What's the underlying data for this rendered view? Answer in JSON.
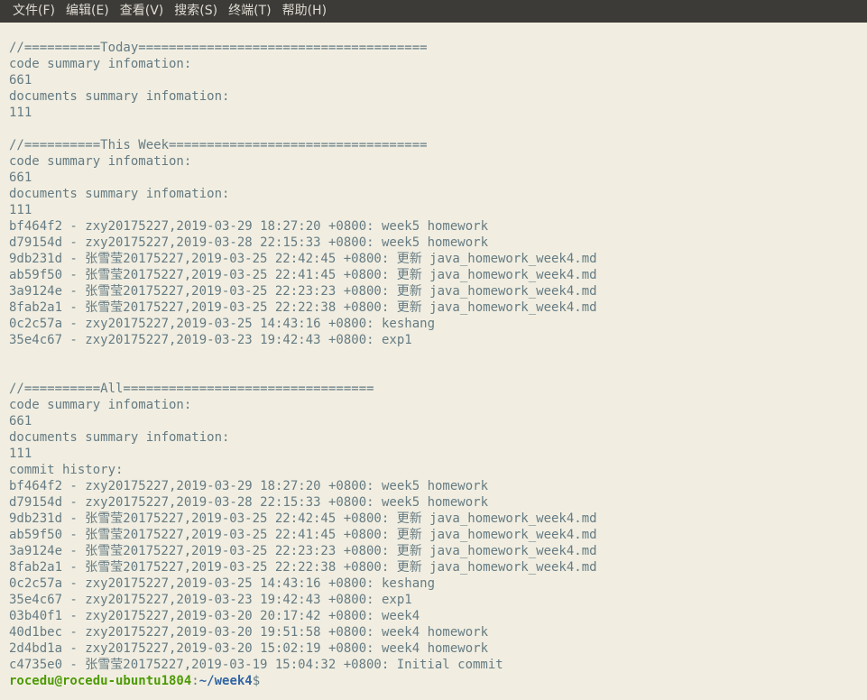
{
  "menubar": {
    "items": [
      "文件(F)",
      "编辑(E)",
      "查看(V)",
      "搜索(S)",
      "终端(T)",
      "帮助(H)"
    ]
  },
  "terminal": {
    "lines": [
      "//==========Today======================================",
      "code summary infomation:",
      "661",
      "documents summary infomation:",
      "111",
      "",
      "//==========This Week==================================",
      "code summary infomation:",
      "661",
      "documents summary infomation:",
      "111",
      "bf464f2 - zxy20175227,2019-03-29 18:27:20 +0800: week5 homework",
      "d79154d - zxy20175227,2019-03-28 22:15:33 +0800: week5 homework",
      "9db231d - 张雪莹20175227,2019-03-25 22:42:45 +0800: 更新 java_homework_week4.md",
      "ab59f50 - 张雪莹20175227,2019-03-25 22:41:45 +0800: 更新 java_homework_week4.md",
      "3a9124e - 张雪莹20175227,2019-03-25 22:23:23 +0800: 更新 java_homework_week4.md",
      "8fab2a1 - 张雪莹20175227,2019-03-25 22:22:38 +0800: 更新 java_homework_week4.md",
      "0c2c57a - zxy20175227,2019-03-25 14:43:16 +0800: keshang",
      "35e4c67 - zxy20175227,2019-03-23 19:42:43 +0800: exp1",
      "",
      "",
      "//==========All=================================",
      "code summary infomation:",
      "661",
      "documents summary infomation:",
      "111",
      "commit history:",
      "bf464f2 - zxy20175227,2019-03-29 18:27:20 +0800: week5 homework",
      "d79154d - zxy20175227,2019-03-28 22:15:33 +0800: week5 homework",
      "9db231d - 张雪莹20175227,2019-03-25 22:42:45 +0800: 更新 java_homework_week4.md",
      "ab59f50 - 张雪莹20175227,2019-03-25 22:41:45 +0800: 更新 java_homework_week4.md",
      "3a9124e - 张雪莹20175227,2019-03-25 22:23:23 +0800: 更新 java_homework_week4.md",
      "8fab2a1 - 张雪莹20175227,2019-03-25 22:22:38 +0800: 更新 java_homework_week4.md",
      "0c2c57a - zxy20175227,2019-03-25 14:43:16 +0800: keshang",
      "35e4c67 - zxy20175227,2019-03-23 19:42:43 +0800: exp1",
      "03b40f1 - zxy20175227,2019-03-20 20:17:42 +0800: week4",
      "40d1bec - zxy20175227,2019-03-20 19:51:58 +0800: week4 homework",
      "2d4bd1a - zxy20175227,2019-03-20 15:02:19 +0800: week4 homework",
      "c4735e0 - 张雪莹20175227,2019-03-19 15:04:32 +0800: Initial commit"
    ],
    "prompt": {
      "user_host": "rocedu@rocedu-ubuntu1804",
      "separator": ":",
      "path": "~/week4",
      "symbol": "$"
    }
  },
  "colors": {
    "background": "#f1eee1",
    "text": "#657b83",
    "menubar": "#3c3b37",
    "prompt_user": "#4e9a06",
    "prompt_path": "#3465a4"
  }
}
